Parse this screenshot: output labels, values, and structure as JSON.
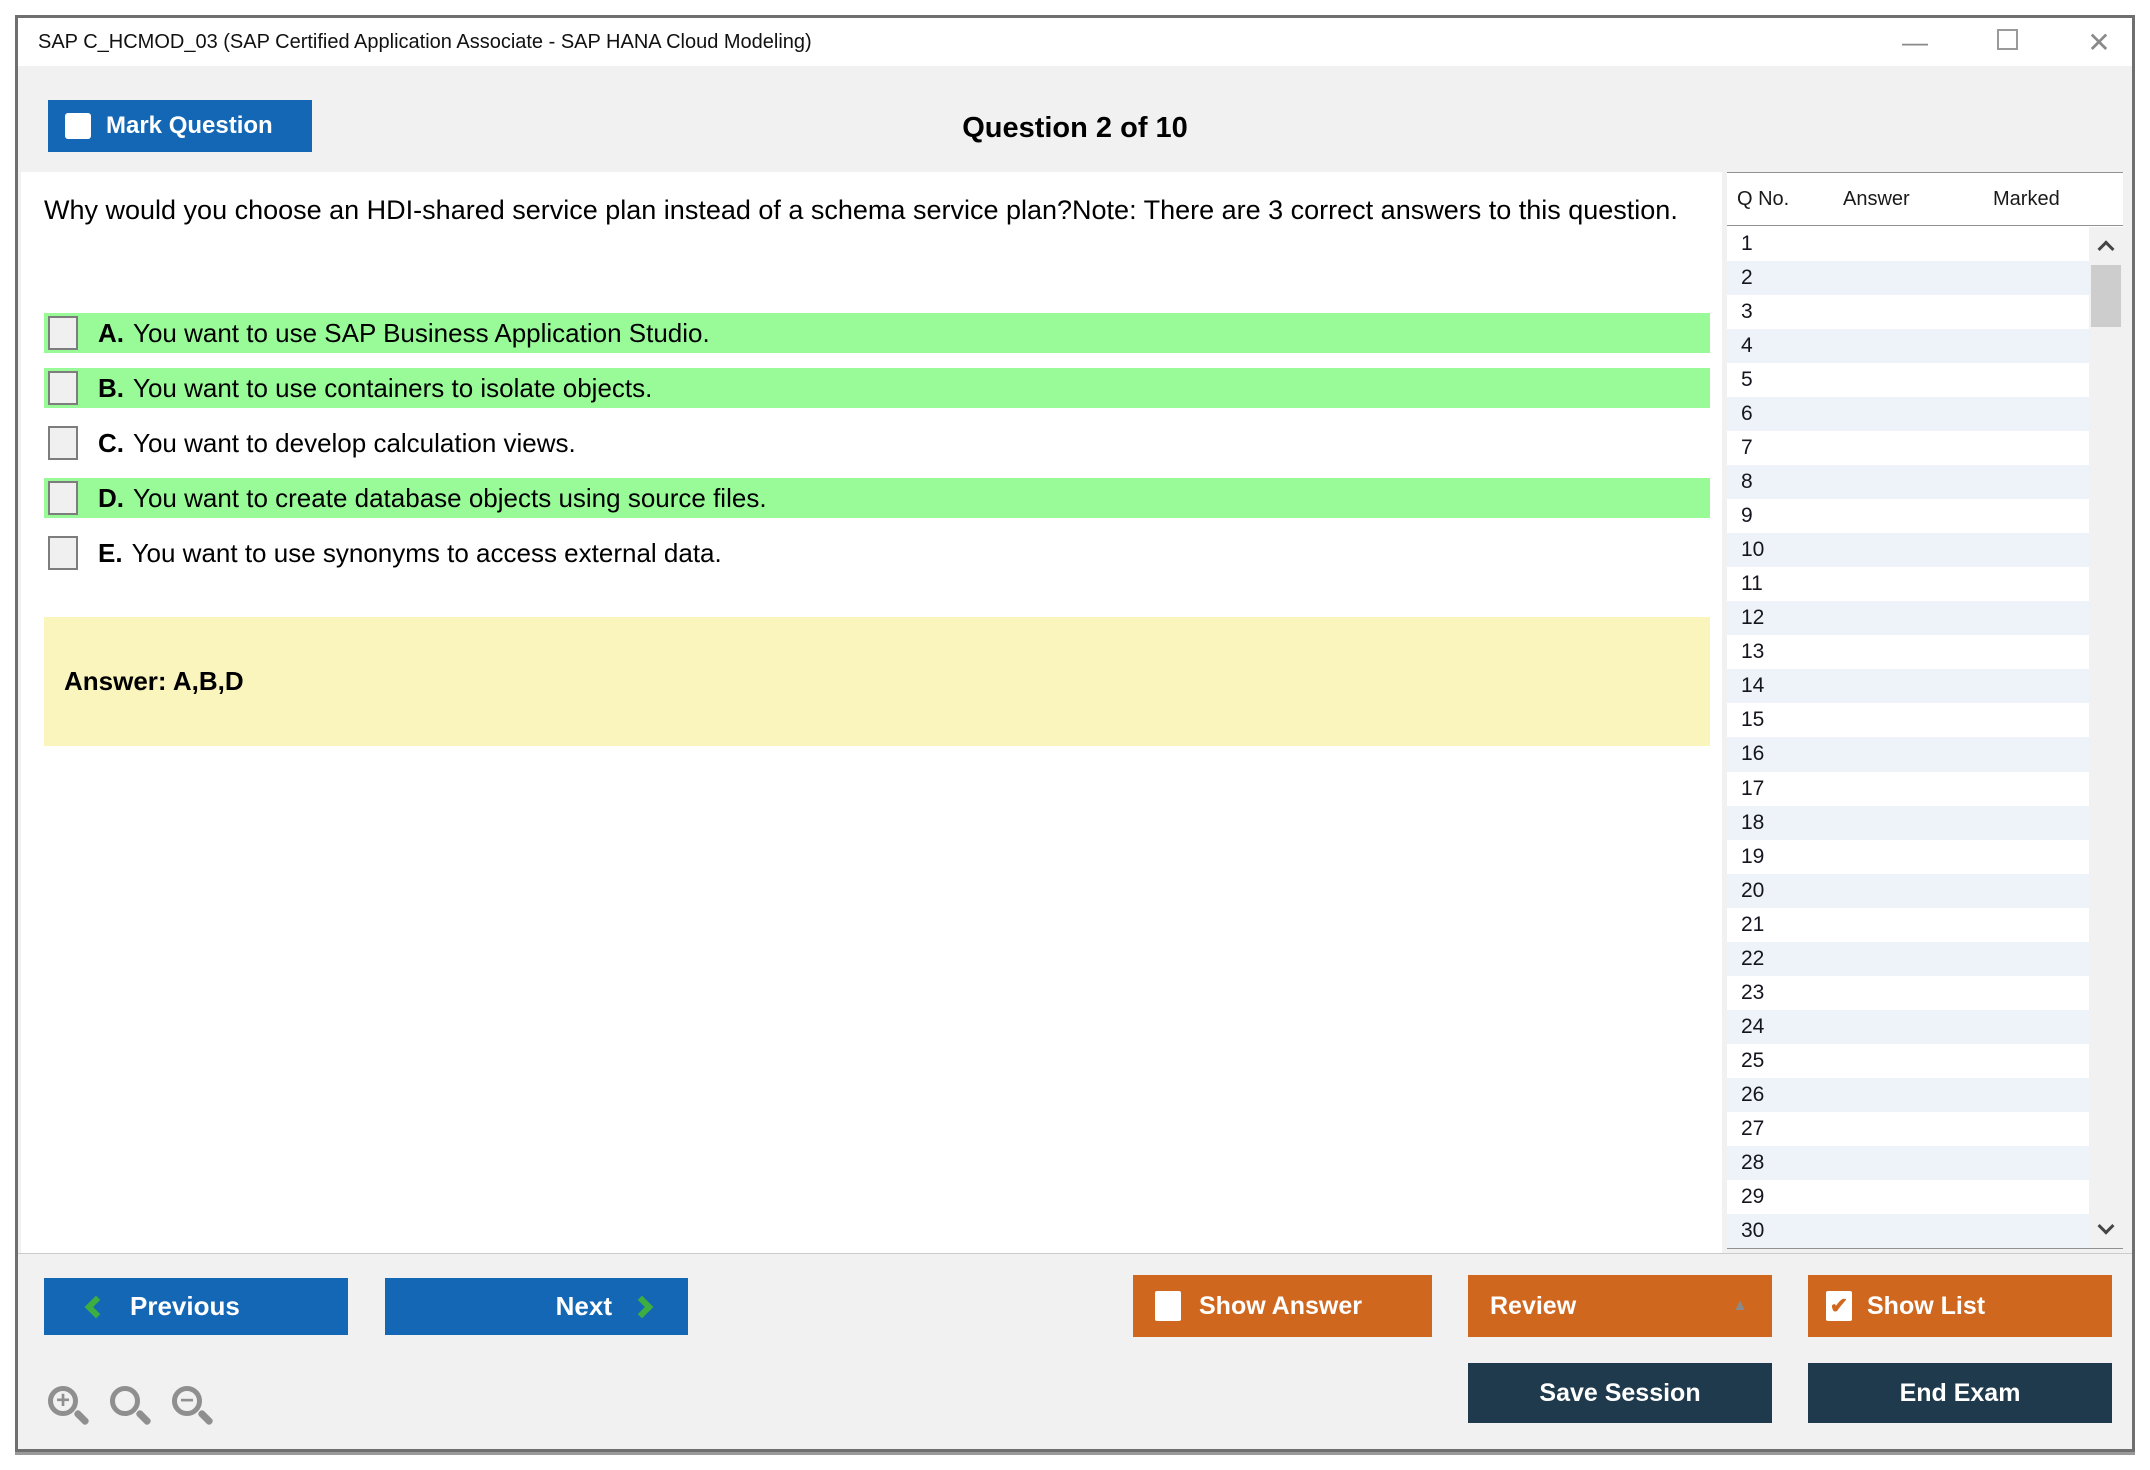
{
  "window": {
    "title": "SAP C_HCMOD_03 (SAP Certified Application Associate - SAP HANA Cloud Modeling)"
  },
  "icons": {
    "minimize": "—",
    "close": "✕",
    "checkmark": "✔",
    "review_arrow": "▲"
  },
  "header": {
    "mark_question_label": "Mark Question",
    "question_counter": "Question 2 of 10"
  },
  "question": {
    "text": "Why would you choose an HDI-shared service plan instead of a schema service plan?Note: There are 3 correct answers to this question.",
    "options": [
      {
        "letter": "A.",
        "text": "You want to use SAP Business Application Studio.",
        "highlighted": true,
        "checked": false
      },
      {
        "letter": "B.",
        "text": "You want to use containers to isolate objects.",
        "highlighted": true,
        "checked": false
      },
      {
        "letter": "C.",
        "text": "You want to develop calculation views.",
        "highlighted": false,
        "checked": false
      },
      {
        "letter": "D.",
        "text": "You want to create database objects using source files.",
        "highlighted": true,
        "checked": false
      },
      {
        "letter": "E.",
        "text": "You want to use synonyms to access external data.",
        "highlighted": false,
        "checked": false
      }
    ],
    "answer_label": "Answer: A,B,D"
  },
  "sidebar": {
    "columns": [
      "Q No.",
      "Answer",
      "Marked"
    ],
    "rows": [
      {
        "q_no": "1",
        "answer": "",
        "marked": ""
      },
      {
        "q_no": "2",
        "answer": "",
        "marked": ""
      },
      {
        "q_no": "3",
        "answer": "",
        "marked": ""
      },
      {
        "q_no": "4",
        "answer": "",
        "marked": ""
      },
      {
        "q_no": "5",
        "answer": "",
        "marked": ""
      },
      {
        "q_no": "6",
        "answer": "",
        "marked": ""
      },
      {
        "q_no": "7",
        "answer": "",
        "marked": ""
      },
      {
        "q_no": "8",
        "answer": "",
        "marked": ""
      },
      {
        "q_no": "9",
        "answer": "",
        "marked": ""
      },
      {
        "q_no": "10",
        "answer": "",
        "marked": ""
      },
      {
        "q_no": "11",
        "answer": "",
        "marked": ""
      },
      {
        "q_no": "12",
        "answer": "",
        "marked": ""
      },
      {
        "q_no": "13",
        "answer": "",
        "marked": ""
      },
      {
        "q_no": "14",
        "answer": "",
        "marked": ""
      },
      {
        "q_no": "15",
        "answer": "",
        "marked": ""
      },
      {
        "q_no": "16",
        "answer": "",
        "marked": ""
      },
      {
        "q_no": "17",
        "answer": "",
        "marked": ""
      },
      {
        "q_no": "18",
        "answer": "",
        "marked": ""
      },
      {
        "q_no": "19",
        "answer": "",
        "marked": ""
      },
      {
        "q_no": "20",
        "answer": "",
        "marked": ""
      },
      {
        "q_no": "21",
        "answer": "",
        "marked": ""
      },
      {
        "q_no": "22",
        "answer": "",
        "marked": ""
      },
      {
        "q_no": "23",
        "answer": "",
        "marked": ""
      },
      {
        "q_no": "24",
        "answer": "",
        "marked": ""
      },
      {
        "q_no": "25",
        "answer": "",
        "marked": ""
      },
      {
        "q_no": "26",
        "answer": "",
        "marked": ""
      },
      {
        "q_no": "27",
        "answer": "",
        "marked": ""
      },
      {
        "q_no": "28",
        "answer": "",
        "marked": ""
      },
      {
        "q_no": "29",
        "answer": "",
        "marked": ""
      },
      {
        "q_no": "30",
        "answer": "",
        "marked": ""
      }
    ]
  },
  "footer": {
    "previous_label": "Previous",
    "next_label": "Next",
    "show_answer_label": "Show Answer",
    "review_label": "Review",
    "show_list_label": "Show List",
    "save_session_label": "Save Session",
    "end_exam_label": "End Exam"
  },
  "colors": {
    "accent_blue": "#1467b4",
    "accent_orange": "#d0671f",
    "accent_navy": "#1f3a4d",
    "correct_highlight_green": "#98fb98",
    "answer_box_yellow": "#faf5bd",
    "sidebar_alt_row": "#edf3f9",
    "chevron_green": "#3fae41",
    "body_gray": "#f1f1f1"
  }
}
